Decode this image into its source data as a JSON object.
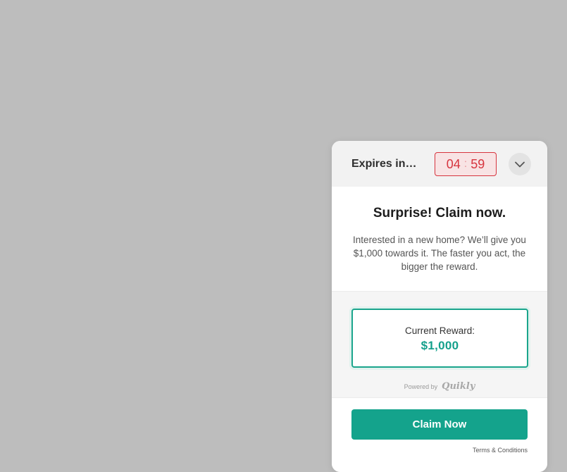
{
  "widget": {
    "header": {
      "expires_label": "Expires in…",
      "timer": {
        "minutes": "04",
        "separator": ":",
        "seconds": "59"
      },
      "collapse_icon": "chevron-down-icon"
    },
    "headline": "Surprise! Claim now.",
    "description": "Interested in a new home? We’ll give you $1,000 towards it. The faster you act, the bigger the reward.",
    "reward": {
      "label": "Current Reward:",
      "value": "$1,000"
    },
    "powered_by": {
      "label": "Powered by",
      "brand": "Quikly"
    },
    "cta": {
      "label": "Claim Now"
    },
    "terms": "Terms & Conditions"
  },
  "colors": {
    "background": "#bdbdbd",
    "accent": "#14a38c",
    "timer": "#d7343e"
  }
}
